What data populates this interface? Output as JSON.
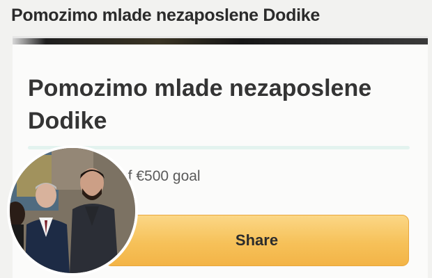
{
  "page": {
    "top_title": "Pomozimo mlade nezaposlene Dodike"
  },
  "campaign": {
    "title": "Pomozimo mlade nezaposlene Dodike",
    "goal_text": "of €500 goal",
    "progress_fraction": 0.0,
    "share_label": "Share"
  },
  "colors": {
    "share_button": "#f6c159",
    "progress_track": "#e3f3ef",
    "title_text": "#343434"
  },
  "icons": {
    "photo": "people-photo"
  }
}
